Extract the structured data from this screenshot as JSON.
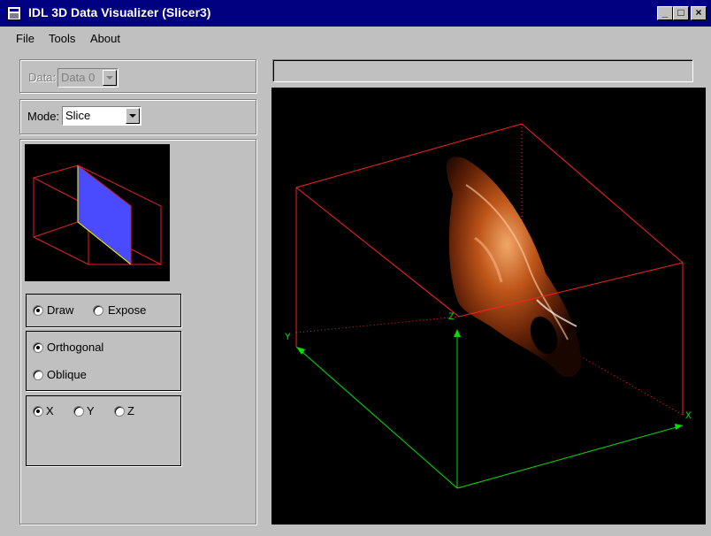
{
  "window": {
    "title": "IDL 3D Data Visualizer (Slicer3)",
    "controls": {
      "minimize": "_",
      "maximize": "□",
      "close": "×"
    }
  },
  "menu": {
    "items": [
      "File",
      "Tools",
      "About"
    ]
  },
  "data_select": {
    "label": "Data:",
    "value": "Data 0",
    "enabled": false
  },
  "mode_select": {
    "label": "Mode:",
    "value": "Slice"
  },
  "draw_group": {
    "options": [
      {
        "label": "Draw",
        "checked": true
      },
      {
        "label": "Expose",
        "checked": false
      }
    ]
  },
  "orientation_group": {
    "options": [
      {
        "label": "Orthogonal",
        "checked": true
      },
      {
        "label": "Oblique",
        "checked": false
      }
    ]
  },
  "axis_group": {
    "options": [
      {
        "label": "X",
        "checked": true
      },
      {
        "label": "Y",
        "checked": false
      },
      {
        "label": "Z",
        "checked": false
      }
    ]
  },
  "status_field": {
    "value": ""
  },
  "viewport": {
    "axis_labels": {
      "x": "X",
      "y": "Y",
      "z": "Z"
    },
    "colors": {
      "bounding_box": "#ff2020",
      "axes": "#00e000",
      "slice_plane": "#4a4aff",
      "slice_outline": "#ffff00"
    }
  }
}
